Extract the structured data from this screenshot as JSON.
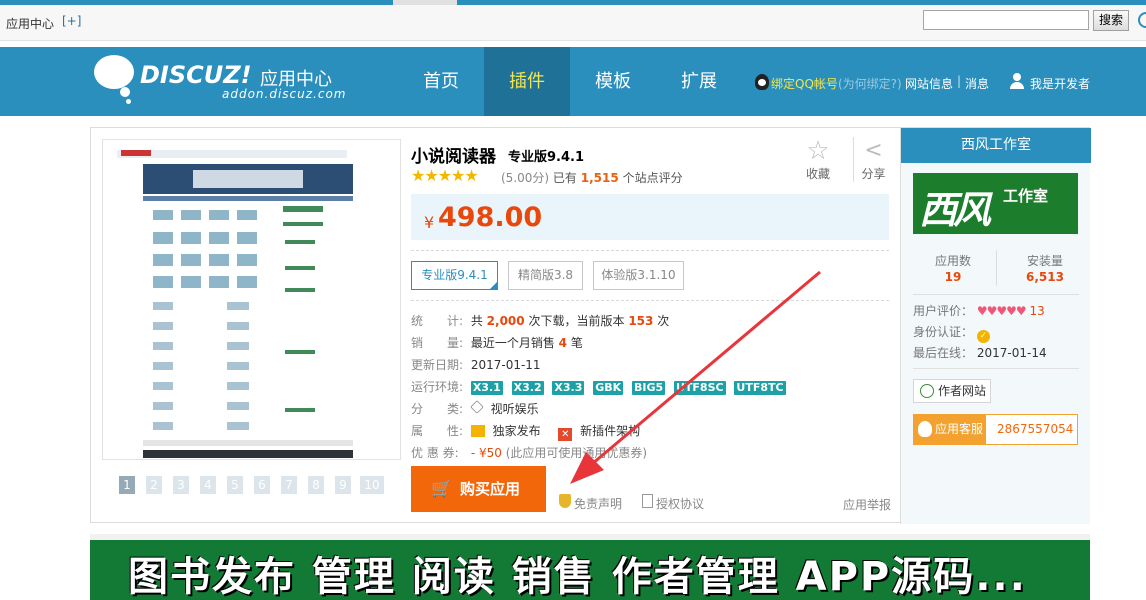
{
  "topbar": {
    "home_label": "应用中心",
    "add_label": "[+]",
    "search_value": "",
    "search_button": "搜索"
  },
  "header": {
    "logo_text": "DISCUZ!",
    "logo_cn": "应用中心",
    "logo_sub": "addon.discuz.com",
    "nav": [
      "首页",
      "插件",
      "模板",
      "扩展"
    ],
    "active_nav": "插件",
    "qq_bind": "绑定QQ帐号",
    "qq_why": "(为何绑定?)",
    "site_info": "网站信息",
    "sep": "|",
    "messages": "消息",
    "developer": "我是开发者"
  },
  "product": {
    "title": "小说阅读器",
    "version_title": "专业版9.4.1",
    "stars": "★★★★★",
    "score": "(5.00分)",
    "have_label": "已有",
    "rating_count": "1,515",
    "rating_suffix": "个站点评分",
    "favorite_label": "收藏",
    "share_label": "分享",
    "price_symbol": "¥",
    "price": "498.00",
    "pages": [
      "1",
      "2",
      "3",
      "4",
      "5",
      "6",
      "7",
      "8",
      "9",
      "10"
    ],
    "versions": [
      "专业版9.4.1",
      "精简版3.8",
      "体验版3.1.10"
    ],
    "stats": {
      "label": "统　　计:",
      "pre": "共",
      "downloads": "2,000",
      "mid": "次下载，当前版本",
      "current": "153",
      "post": "次"
    },
    "sales": {
      "label": "销　　量:",
      "pre": "最近一个月销售",
      "count": "4",
      "post": "笔"
    },
    "updated": {
      "label": "更新日期:",
      "value": "2017-01-11"
    },
    "env": {
      "label": "运行环境:",
      "tags": [
        "X3.1",
        "X3.2",
        "X3.3",
        "GBK",
        "BIG5",
        "UTF8SC",
        "UTF8TC"
      ]
    },
    "category": {
      "label": "分　　类:",
      "value": "视听娱乐"
    },
    "props": {
      "label": "属　　性:",
      "exclusive": "独家发布",
      "new_plugin": "新插件架构"
    },
    "coupon": {
      "label": "优 惠 券:",
      "value": "- ¥50",
      "desc": "(此应用可使用通用优惠券)"
    },
    "buy_label": "购买应用",
    "disclaimer": "免责声明",
    "license": "授权协议",
    "report": "应用举报"
  },
  "developer": {
    "name": "西风工作室",
    "logo_big": "西风",
    "logo_small": "工作室",
    "apps_label": "应用数",
    "apps": "19",
    "installs_label": "安装量",
    "installs": "6,513",
    "rating_label": "用户评价：",
    "hearts": "♥♥♥♥♥",
    "rating_count": "13",
    "verified_label": "身份认证：",
    "verified_icon": "✓",
    "last_online_label": "最后在线：",
    "last_online": "2017-01-14",
    "site_label": "作者网站",
    "service_label": "应用客服",
    "service_number": "2867557054"
  },
  "banner": {
    "text": "图书发布 管理 阅读 销售 作者管理 APP源码..."
  },
  "colors": {
    "brand": "#2a8fbd",
    "accent": "#f3670b",
    "price": "#e8480b"
  }
}
